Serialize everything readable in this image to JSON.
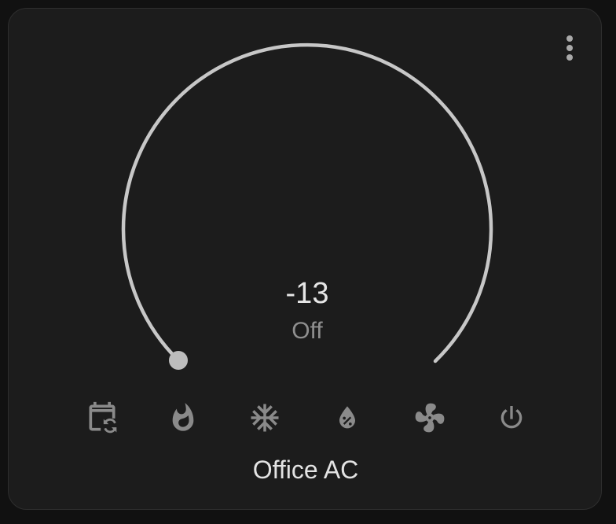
{
  "card": {
    "target_temperature": "-13",
    "hvac_state": "Off",
    "name": "Office AC"
  },
  "dial": {
    "setpoint_fraction": 0.0,
    "color": "#c7c7c7"
  },
  "modes": [
    {
      "icon": "calendar-sync-icon",
      "mode": "auto"
    },
    {
      "icon": "fire-icon",
      "mode": "heat"
    },
    {
      "icon": "snowflake-icon",
      "mode": "cool"
    },
    {
      "icon": "water-percent-icon",
      "mode": "dry"
    },
    {
      "icon": "fan-icon",
      "mode": "fan_only"
    },
    {
      "icon": "power-icon",
      "mode": "off"
    }
  ],
  "colors": {
    "background": "#111111",
    "card": "#1c1c1c",
    "icon": "#8a8a8a",
    "text": "#e3e3e3"
  }
}
